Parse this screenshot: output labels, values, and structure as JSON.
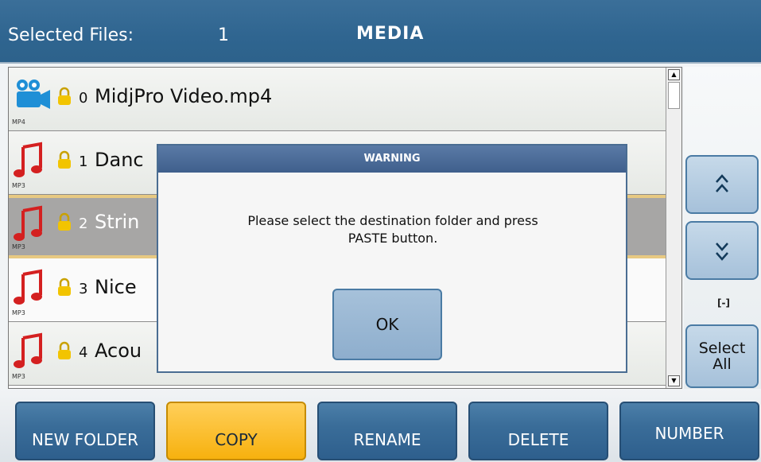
{
  "header": {
    "selected_files_label": "Selected Files:",
    "selected_files_count": "1",
    "title": "MEDIA"
  },
  "files": [
    {
      "index": "0",
      "name": "MidjPro Video.mp4",
      "type": "MP4",
      "icon": "video-camera-icon"
    },
    {
      "index": "1",
      "name": "Danc",
      "type": "MP3",
      "icon": "music-note-icon"
    },
    {
      "index": "2",
      "name": "Strin",
      "type": "MP3",
      "icon": "music-note-icon",
      "selected": true
    },
    {
      "index": "3",
      "name": "Nice",
      "type": "MP3",
      "icon": "music-note-icon"
    },
    {
      "index": "4",
      "name": "Acou",
      "type": "MP3",
      "icon": "music-note-icon"
    }
  ],
  "side": {
    "up_label": "^",
    "down_label": "v",
    "range_tag": "[-]",
    "select_all_line1": "Select",
    "select_all_line2": "All"
  },
  "dialog": {
    "title": "WARNING",
    "line1": "Please select the destination folder and press",
    "line2": "PASTE button.",
    "ok_label": "OK"
  },
  "toolbar": {
    "new_folder": "NEW FOLDER",
    "copy": "COPY",
    "rename": "RENAME",
    "delete": "DELETE",
    "number": "NUMBER"
  },
  "colors": {
    "header": "#2f6590",
    "accent_active": "#f7b10e",
    "note_red": "#d42020",
    "video_blue": "#1f8fd6",
    "lock_yellow": "#f2c400"
  }
}
